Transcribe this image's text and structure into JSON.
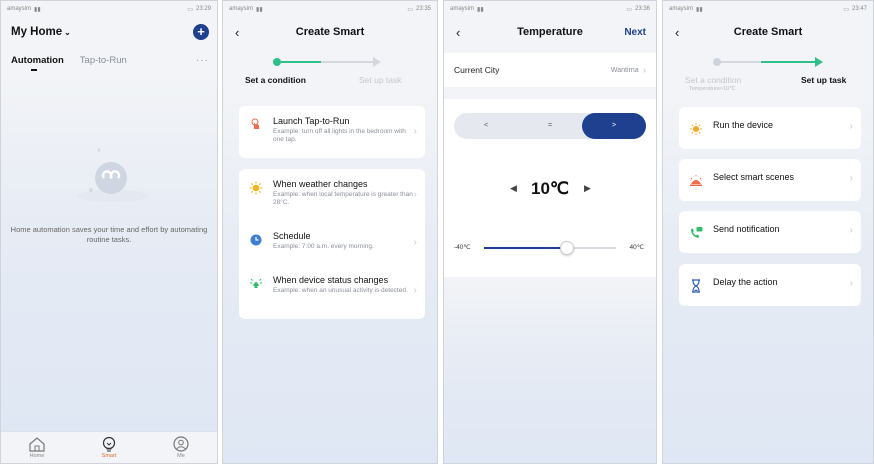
{
  "colors": {
    "accent": "#1f3f8f",
    "green": "#2fbf8a",
    "orange": "#e06a2a",
    "muted": "#8a8f99"
  },
  "phone1": {
    "status": {
      "carrier": "amaysim",
      "time": "23:29"
    },
    "home_title": "My Home",
    "tabs": [
      "Automation",
      "Tap-to-Run"
    ],
    "more_label": "···",
    "empty_text": "Home automation saves your time and effort by automating routine tasks.",
    "tabbar": [
      {
        "label": "Home",
        "icon": "home-icon"
      },
      {
        "label": "Smart",
        "icon": "lightbulb-icon"
      },
      {
        "label": "Me",
        "icon": "profile-icon"
      }
    ]
  },
  "phone2": {
    "status": {
      "carrier": "amaysim",
      "time": "23:35"
    },
    "title": "Create Smart",
    "steps": [
      "Set a condition",
      "Set up task"
    ],
    "card1": [
      {
        "title": "Launch Tap-to-Run",
        "subtitle": "Example: turn off all lights in the bedroom with one tap.",
        "icon": "tap-hand-icon"
      }
    ],
    "card2": [
      {
        "title": "When weather changes",
        "subtitle": "Example: when local temperature is greater than 28°C.",
        "icon": "sun-icon"
      },
      {
        "title": "Schedule",
        "subtitle": "Example: 7:00 a.m. every morning.",
        "icon": "clock-icon"
      },
      {
        "title": "When device status changes",
        "subtitle": "Example: when an unusual activity is detected.",
        "icon": "device-icon"
      }
    ]
  },
  "phone3": {
    "status": {
      "carrier": "amaysim",
      "time": "23:36"
    },
    "title": "Temperature",
    "next_label": "Next",
    "city_label": "Current City",
    "city_value": "Wantirna",
    "segments": [
      "<",
      "=",
      ">"
    ],
    "selected_segment": 2,
    "temp_value": "10℃",
    "slider_min": "-40℃",
    "slider_max": "40℃",
    "slider_value": 10
  },
  "phone4": {
    "status": {
      "carrier": "amaysim",
      "time": "23:47"
    },
    "title": "Create Smart",
    "steps": [
      "Set a condition",
      "Set up task"
    ],
    "step_sub": "Temperature>10℃",
    "actions": [
      {
        "label": "Run the device",
        "icon": "sun-device-icon"
      },
      {
        "label": "Select smart scenes",
        "icon": "scene-icon"
      },
      {
        "label": "Send notification",
        "icon": "phone-message-icon"
      },
      {
        "label": "Delay the action",
        "icon": "hourglass-icon"
      }
    ]
  }
}
